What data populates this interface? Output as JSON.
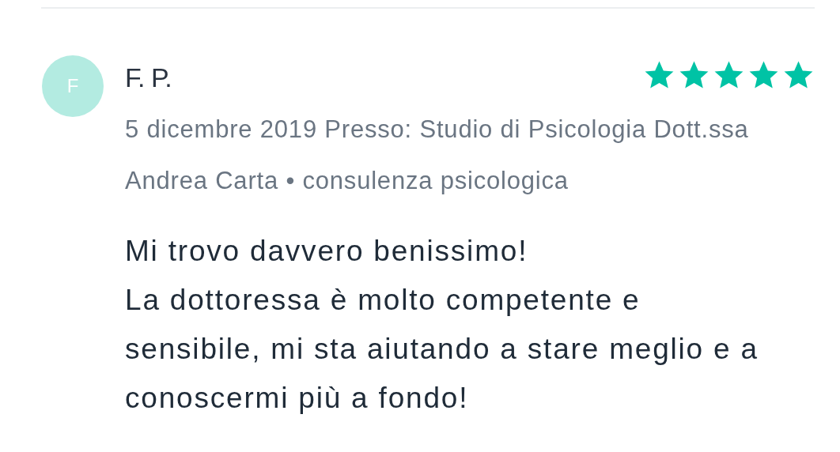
{
  "review": {
    "avatar_initial": "F",
    "author": "F. P.",
    "stars": 5,
    "meta": "5 dicembre 2019 Presso: Studio di Psicologia Dott.ssa Andrea Carta • consulenza psicologica",
    "text": "Mi trovo davvero benissimo!\nLa dottoressa è molto competente e sensibile, mi sta aiutando a stare meglio e a conoscermi più a fondo!"
  }
}
